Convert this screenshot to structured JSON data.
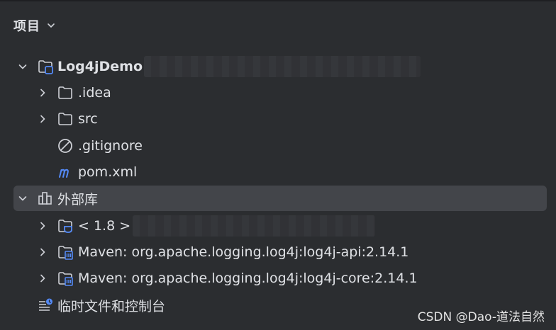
{
  "panel": {
    "title": "项目"
  },
  "tree": {
    "project_root": "Log4jDemo",
    "idea_folder": ".idea",
    "src_folder": "src",
    "gitignore_file": ".gitignore",
    "pom_file": "pom.xml",
    "external_libraries": "外部库",
    "jdk": "< 1.8 >",
    "maven_api": "Maven: org.apache.logging.log4j:log4j-api:2.14.1",
    "maven_core": "Maven: org.apache.logging.log4j:log4j-core:2.14.1",
    "scratches": "临时文件和控制台"
  },
  "watermark": "CSDN @Dao-道法自然",
  "colors": {
    "background": "#2b2d30",
    "selected_row": "#43454a",
    "text": "#dfe1e5",
    "icon_stroke": "#ced0d6",
    "module_accent": "#548af7",
    "maven_blue": "#548af7"
  },
  "icons": {
    "collapse": "chevron-down-icon",
    "expand": "chevron-right-icon",
    "module": "module-folder-icon",
    "folder": "folder-icon",
    "ignore": "ignore-file-icon",
    "maven": "maven-m-icon",
    "library": "library-icon",
    "jdk": "jdk-folder-icon",
    "maven_lib": "maven-library-icon",
    "scratch": "scratches-icon"
  }
}
